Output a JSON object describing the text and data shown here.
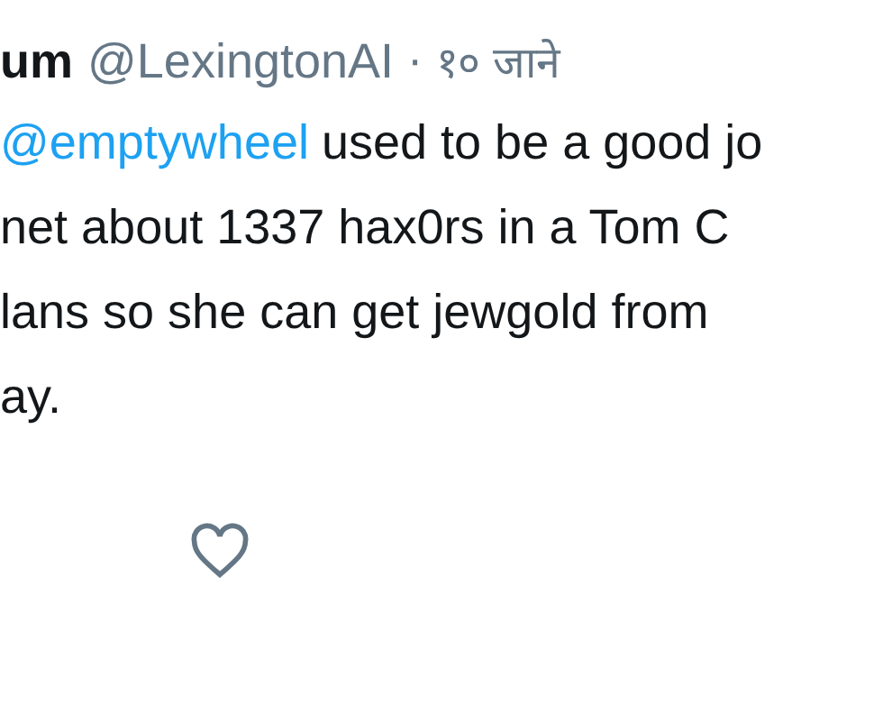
{
  "tweet": {
    "name": "um",
    "handle": "@LexingtonAI",
    "time": "· १० जाने",
    "mention": "@emptywheel",
    "lines": [
      "used to be a good jo",
      "net about 1337 hax0rs in a Tom C",
      "lans so she can get jewgold from",
      "ay."
    ],
    "liked": false
  }
}
